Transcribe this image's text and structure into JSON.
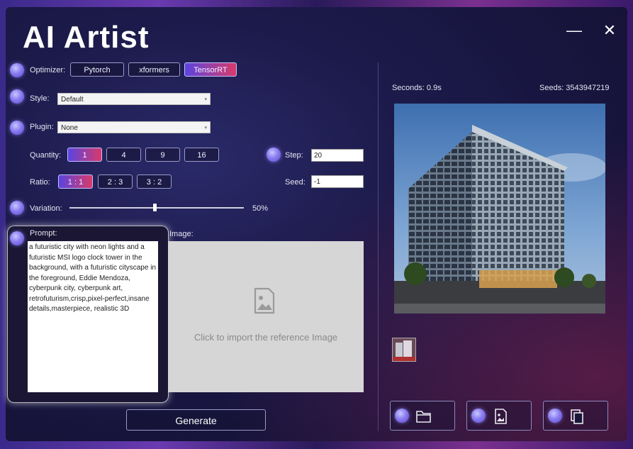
{
  "app": {
    "title": "AI Artist"
  },
  "window_controls": {
    "minimize": "—",
    "close": "✕"
  },
  "optimizer": {
    "label": "Optimizer:",
    "options": [
      "Pytorch",
      "xformers",
      "TensorRT"
    ],
    "selected": "TensorRT"
  },
  "style": {
    "label": "Style:",
    "value": "Default"
  },
  "plugin": {
    "label": "Plugin:",
    "value": "None"
  },
  "quantity": {
    "label": "Quantity:",
    "options": [
      "1",
      "4",
      "9",
      "16"
    ],
    "selected": "1"
  },
  "ratio": {
    "label": "Ratio:",
    "options": [
      "1 : 1",
      "2 : 3",
      "3 : 2"
    ],
    "selected": "1 : 1"
  },
  "step": {
    "label": "Step:",
    "value": "20"
  },
  "seed": {
    "label": "Seed:",
    "value": "-1"
  },
  "variation": {
    "label": "Variation:",
    "value_text": "50%",
    "value": 0.5
  },
  "prompt": {
    "label": "Prompt:",
    "text": "a futuristic city with neon lights and a futuristic MSI logo clock tower in the background, with a futuristic cityscape in the foreground, Eddie Mendoza, cyberpunk city, cyberpunk art, retrofuturism,crisp,pixel-perfect,insane details,masterpiece, realistic 3D"
  },
  "image": {
    "label": "Image:",
    "placeholder": "Click to import the reference Image",
    "icon": "image-placeholder-icon"
  },
  "generate": {
    "label": "Generate"
  },
  "result": {
    "seconds": "Seconds: 0.9s",
    "seeds": "Seeds: 3543947219"
  },
  "actions": [
    {
      "name": "open-folder-button",
      "icon": "folder-icon"
    },
    {
      "name": "save-image-button",
      "icon": "image-file-icon"
    },
    {
      "name": "copy-button",
      "icon": "copy-icon"
    }
  ],
  "colors": {
    "accent_start": "#5a44e0",
    "accent_end": "#d83a6a",
    "background": "#1c1a4a"
  }
}
